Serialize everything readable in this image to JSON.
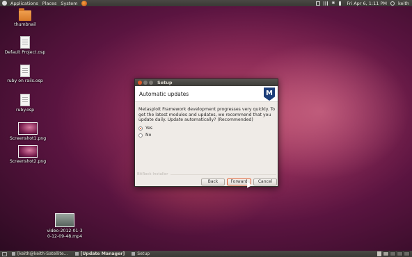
{
  "top_panel": {
    "menus": [
      "Applications",
      "Places",
      "System"
    ],
    "clock": "Fri Apr 6, 1:11 PM",
    "user": "keith"
  },
  "desktop_icons": [
    {
      "label": "thumbnail",
      "type": "folder"
    },
    {
      "label": "Default Project.osp",
      "type": "file"
    },
    {
      "label": "ruby on rails.osp",
      "type": "file"
    },
    {
      "label": "ruby.osp",
      "type": "file"
    },
    {
      "label": "Screenshot1.png",
      "type": "image"
    },
    {
      "label": "Screenshot2.png",
      "type": "image"
    },
    {
      "label": "video-2012-01-30-12-09-48.mp4",
      "type": "video"
    }
  ],
  "dialog": {
    "window_title": "Setup",
    "header": "Automatic updates",
    "logo_letter": "M",
    "message": "Metasploit Framework development progresses very quickly. To get the latest modules and updates, we recommend that you update daily. Update automatically? (Recommended)",
    "options": [
      {
        "label": "Yes",
        "selected": true
      },
      {
        "label": "No",
        "selected": false
      }
    ],
    "installer_label": "BitRock Installer",
    "buttons": {
      "back": "Back",
      "forward": "Forward",
      "cancel": "Cancel"
    }
  },
  "taskbar": {
    "items": [
      {
        "label": "[keith@keith-Satellite..."
      },
      {
        "label": "[Update Manager]"
      },
      {
        "label": "Setup"
      }
    ]
  },
  "colors": {
    "accent": "#e05a2b",
    "panel": "#3c3b37",
    "logo": "#1c3e7a"
  }
}
